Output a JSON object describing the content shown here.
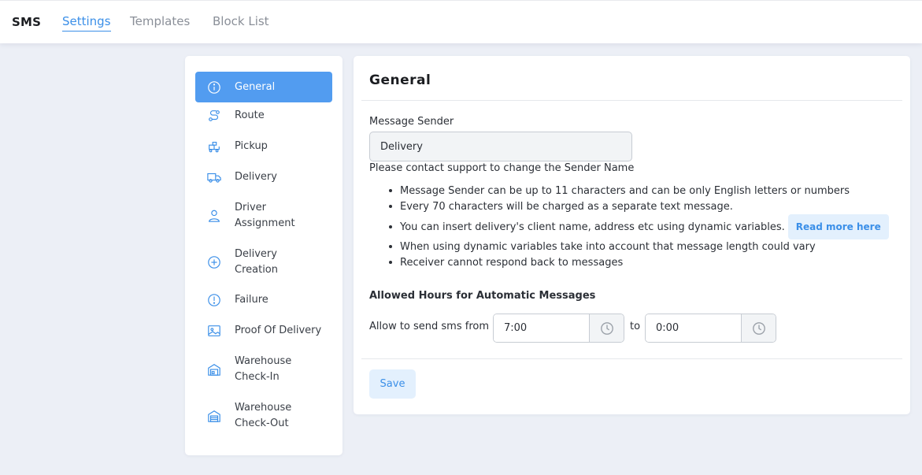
{
  "header": {
    "brand": "SMS",
    "tabs": [
      {
        "label": "Settings",
        "active": true
      },
      {
        "label": "Templates",
        "active": false
      },
      {
        "label": "Block List",
        "active": false
      }
    ]
  },
  "sidebar": {
    "items": [
      {
        "label": "General",
        "icon": "info-circle-icon",
        "active": true
      },
      {
        "label": "Route",
        "icon": "route-icon"
      },
      {
        "label": "Pickup",
        "icon": "pickup-icon"
      },
      {
        "label": "Delivery",
        "icon": "truck-icon"
      },
      {
        "label": "Driver\nAssignment",
        "icon": "user-icon"
      },
      {
        "label": "Delivery\nCreation",
        "icon": "plus-circle-icon"
      },
      {
        "label": "Failure",
        "icon": "exclamation-circle-icon"
      },
      {
        "label": "Proof Of Delivery",
        "icon": "image-icon"
      },
      {
        "label": "Warehouse\nCheck-In",
        "icon": "warehouse-in-icon"
      },
      {
        "label": "Warehouse\nCheck-Out",
        "icon": "warehouse-out-icon"
      }
    ]
  },
  "main": {
    "title": "General",
    "sender": {
      "label": "Message Sender",
      "value": "Delivery",
      "note": "Please contact support to change the Sender Name"
    },
    "bullets": [
      "Message Sender can be up to 11 characters and can be only English letters or numbers",
      "Every 70 characters will be charged as a separate text message.",
      "You can insert delivery's client name, address etc using dynamic variables.",
      "When using dynamic variables take into account that message length could vary",
      "Receiver cannot respond back to messages"
    ],
    "read_more_label": "Read more here",
    "hours": {
      "title": "Allowed Hours for Automatic Messages",
      "from_label": "Allow to send sms from",
      "from_value": "7:00",
      "to_label": "to",
      "to_value": "0:00"
    },
    "save_label": "Save"
  },
  "colors": {
    "accent": "#3b8fe8",
    "active_item_bg": "#529cf0",
    "light_button_bg": "#e3f0fd",
    "page_bg": "#eceff6"
  }
}
